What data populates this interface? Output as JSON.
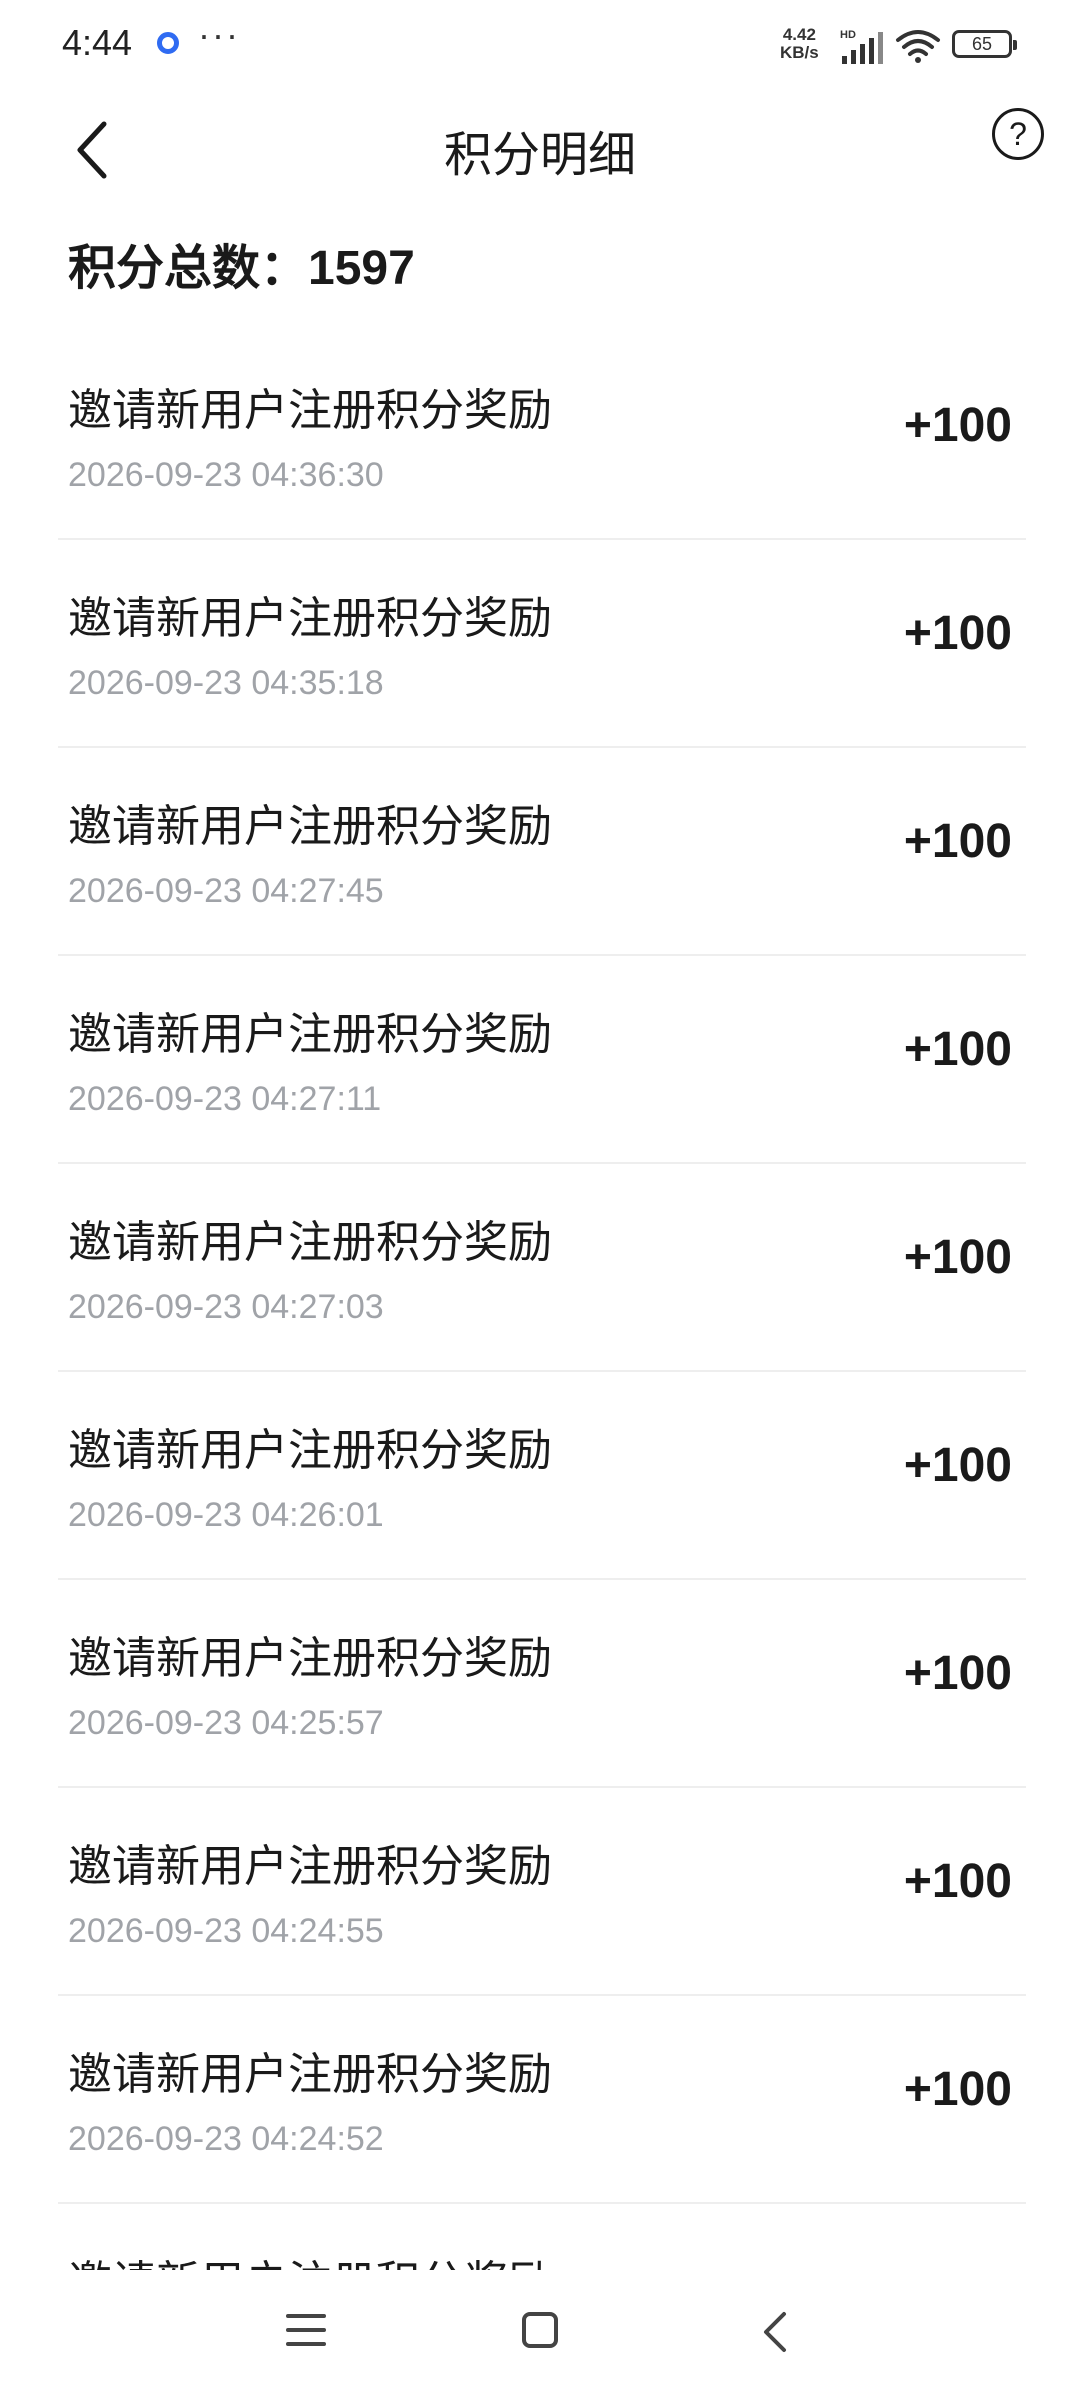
{
  "status_bar": {
    "time": "4:44",
    "more": "···",
    "net_speed_value": "4.42",
    "net_speed_unit": "KB/s",
    "signal_tag": "HD",
    "battery": "65"
  },
  "header": {
    "title": "积分明细",
    "help_glyph": "?"
  },
  "summary": {
    "label": "积分总数：",
    "value": "1597"
  },
  "records": [
    {
      "title": "邀请新用户注册积分奖励",
      "time": "2026-09-23 04:36:30",
      "points": "+100"
    },
    {
      "title": "邀请新用户注册积分奖励",
      "time": "2026-09-23 04:35:18",
      "points": "+100"
    },
    {
      "title": "邀请新用户注册积分奖励",
      "time": "2026-09-23 04:27:45",
      "points": "+100"
    },
    {
      "title": "邀请新用户注册积分奖励",
      "time": "2026-09-23 04:27:11",
      "points": "+100"
    },
    {
      "title": "邀请新用户注册积分奖励",
      "time": "2026-09-23 04:27:03",
      "points": "+100"
    },
    {
      "title": "邀请新用户注册积分奖励",
      "time": "2026-09-23 04:26:01",
      "points": "+100"
    },
    {
      "title": "邀请新用户注册积分奖励",
      "time": "2026-09-23 04:25:57",
      "points": "+100"
    },
    {
      "title": "邀请新用户注册积分奖励",
      "time": "2026-09-23 04:24:55",
      "points": "+100"
    },
    {
      "title": "邀请新用户注册积分奖励",
      "time": "2026-09-23 04:24:52",
      "points": "+100"
    },
    {
      "title": "邀请新用户注册积分奖励",
      "time": "",
      "points": ""
    }
  ],
  "icons": {
    "back": "chevron-left-icon",
    "help": "question-circle-icon",
    "nav_menu": "menu-icon",
    "nav_home": "home-square-icon",
    "nav_back": "back-triangle-icon"
  },
  "colors": {
    "text_primary": "#1a1a1a",
    "text_secondary": "#a0a3a8",
    "divider": "#eeeeee",
    "app_dot": "#2f6bf2"
  }
}
